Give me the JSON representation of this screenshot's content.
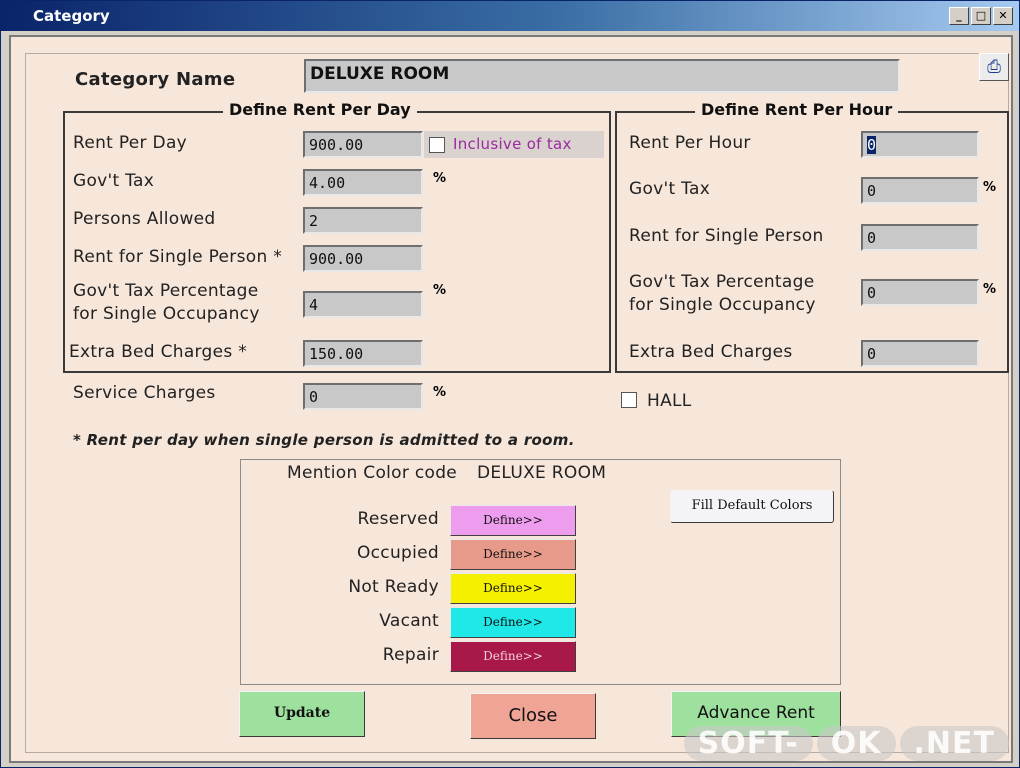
{
  "window": {
    "title": "Category",
    "min": "_",
    "max": "□",
    "close": "✕"
  },
  "category": {
    "label": "Category Name",
    "value": "DELUXE ROOM"
  },
  "per_day": {
    "legend": "Define Rent Per Day",
    "rent_per_day": {
      "label": "Rent Per Day",
      "value": "900.00"
    },
    "inclusive_tax": {
      "label": "Inclusive of tax",
      "checked": false
    },
    "govt_tax": {
      "label": "Gov't Tax",
      "value": "4.00",
      "unit": "%"
    },
    "persons_allowed": {
      "label": "Persons Allowed",
      "value": "2"
    },
    "rent_single": {
      "label": "Rent for Single Person  *",
      "value": "900.00"
    },
    "govt_tax_single": {
      "label_line1": "Gov't Tax Percentage",
      "label_line2": "for Single Occupancy",
      "value": "4",
      "unit": "%"
    },
    "extra_bed": {
      "label": "Extra Bed Charges  *",
      "value": "150.00"
    }
  },
  "service": {
    "label": "Service Charges",
    "value": "0",
    "unit": "%"
  },
  "per_hour": {
    "legend": "Define Rent Per Hour",
    "rent_per_hour": {
      "label": "Rent Per Hour",
      "value": "0"
    },
    "govt_tax": {
      "label": "Gov't Tax",
      "value": "0",
      "unit": "%"
    },
    "rent_single": {
      "label": "Rent for Single Person",
      "value": "0"
    },
    "govt_tax_single": {
      "label_line1": "Gov't Tax Percentage",
      "label_line2": "for Single Occupancy",
      "value": "0",
      "unit": "%"
    },
    "extra_bed": {
      "label": "Extra Bed Charges",
      "value": "0"
    }
  },
  "hall": {
    "label": "HALL",
    "checked": false
  },
  "note": "* Rent per day when single person is admitted to a room.",
  "colors": {
    "heading": "Mention Color code",
    "category": "DELUXE ROOM",
    "fill_default": "Fill Default Colors",
    "define_label": "Define>>",
    "rows": [
      {
        "label": "Reserved",
        "color": "#ee9cee"
      },
      {
        "label": "Occupied",
        "color": "#e89a8a"
      },
      {
        "label": "Not Ready",
        "color": "#f4f000"
      },
      {
        "label": "Vacant",
        "color": "#1ee8e8"
      },
      {
        "label": "Repair",
        "color": "#a81848"
      }
    ]
  },
  "buttons": {
    "update": "Update",
    "close": "Close",
    "advance_rent": "Advance Rent"
  },
  "watermark": {
    "left": "SOFT-",
    "middle": "OK",
    "right": ".NET"
  }
}
